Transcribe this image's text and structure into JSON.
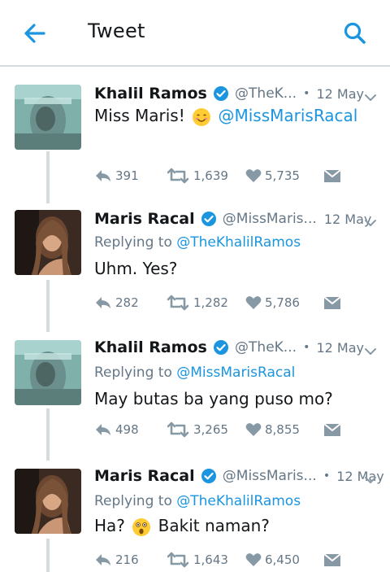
{
  "header": {
    "title": "Tweet",
    "back_icon": "arrow-left-icon",
    "search_icon": "search-icon",
    "accent_color": "#1b95e0"
  },
  "tweets": [
    {
      "name": "Khalil Ramos",
      "verified": true,
      "handle": "@TheK...",
      "date": "12 May",
      "replying_label": "",
      "replying_to": "",
      "text_before": "Miss Maris!",
      "emoji": "smiling-face-emoji",
      "text_mention": "@MissMarisRacal",
      "text_after": "",
      "replies": "391",
      "retweets": "1,639",
      "likes": "5,735"
    },
    {
      "name": "Maris Racal",
      "verified": true,
      "handle": "@MissMaris...",
      "date": "12 May",
      "replying_label": "Replying to",
      "replying_to": "@TheKhalilRamos",
      "text_before": "Uhm. Yes?",
      "emoji": "",
      "text_mention": "",
      "text_after": "",
      "replies": "282",
      "retweets": "1,282",
      "likes": "5,786"
    },
    {
      "name": "Khalil Ramos",
      "verified": true,
      "handle": "@TheK...",
      "date": "12 May",
      "replying_label": "Replying to",
      "replying_to": "@MissMarisRacal",
      "text_before": "May butas ba yang puso mo?",
      "emoji": "",
      "text_mention": "",
      "text_after": "",
      "replies": "498",
      "retweets": "3,265",
      "likes": "8,855"
    },
    {
      "name": "Maris Racal",
      "verified": true,
      "handle": "@MissMaris...",
      "date": "12 May",
      "replying_label": "Replying to",
      "replying_to": "@TheKhalilRamos",
      "text_before": "Ha?",
      "emoji": "astonished-face-emoji",
      "text_mention": "",
      "text_after": "Bakit naman?",
      "replies": "216",
      "retweets": "1,643",
      "likes": "6,450"
    }
  ]
}
